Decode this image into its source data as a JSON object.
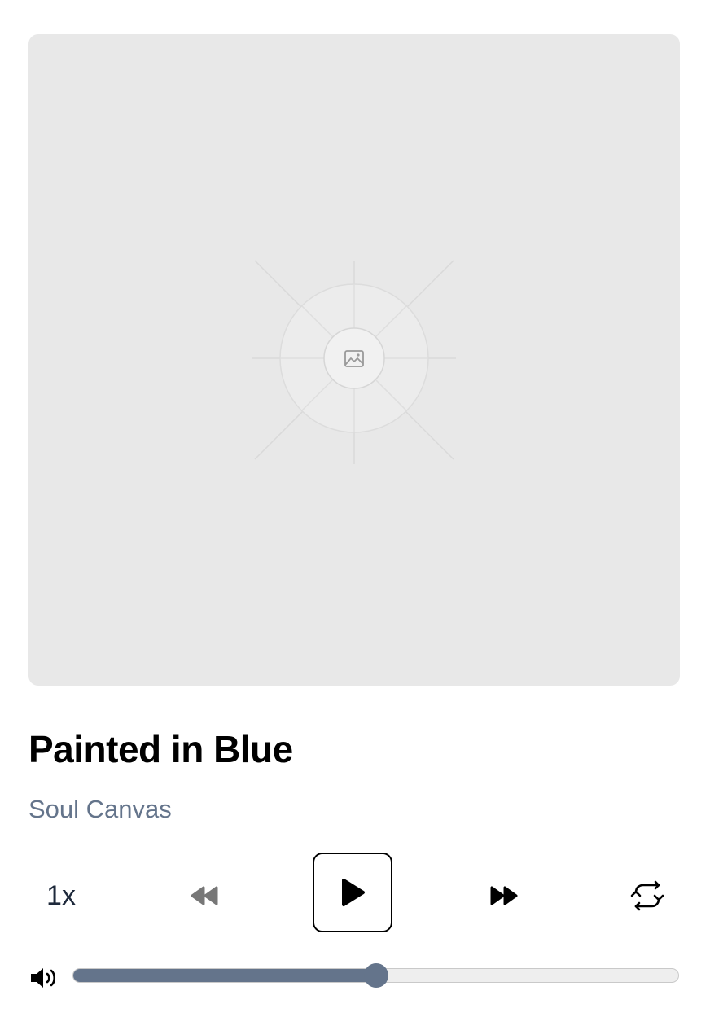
{
  "track": {
    "title": "Painted in Blue",
    "artist": "Soul Canvas"
  },
  "artwork": {
    "placeholder_icon": "image-icon",
    "background_color": "#e8e8e8"
  },
  "controls": {
    "speed_label": "1x",
    "rewind_icon": "rewind-icon",
    "play_icon": "play-icon",
    "forward_icon": "fast-forward-icon",
    "repeat_icon": "repeat-icon"
  },
  "volume": {
    "icon": "volume-icon",
    "level": 0.5
  },
  "colors": {
    "accent": "#64748b",
    "title": "#000000",
    "artist": "#64748b",
    "disabled_control": "#777777"
  }
}
